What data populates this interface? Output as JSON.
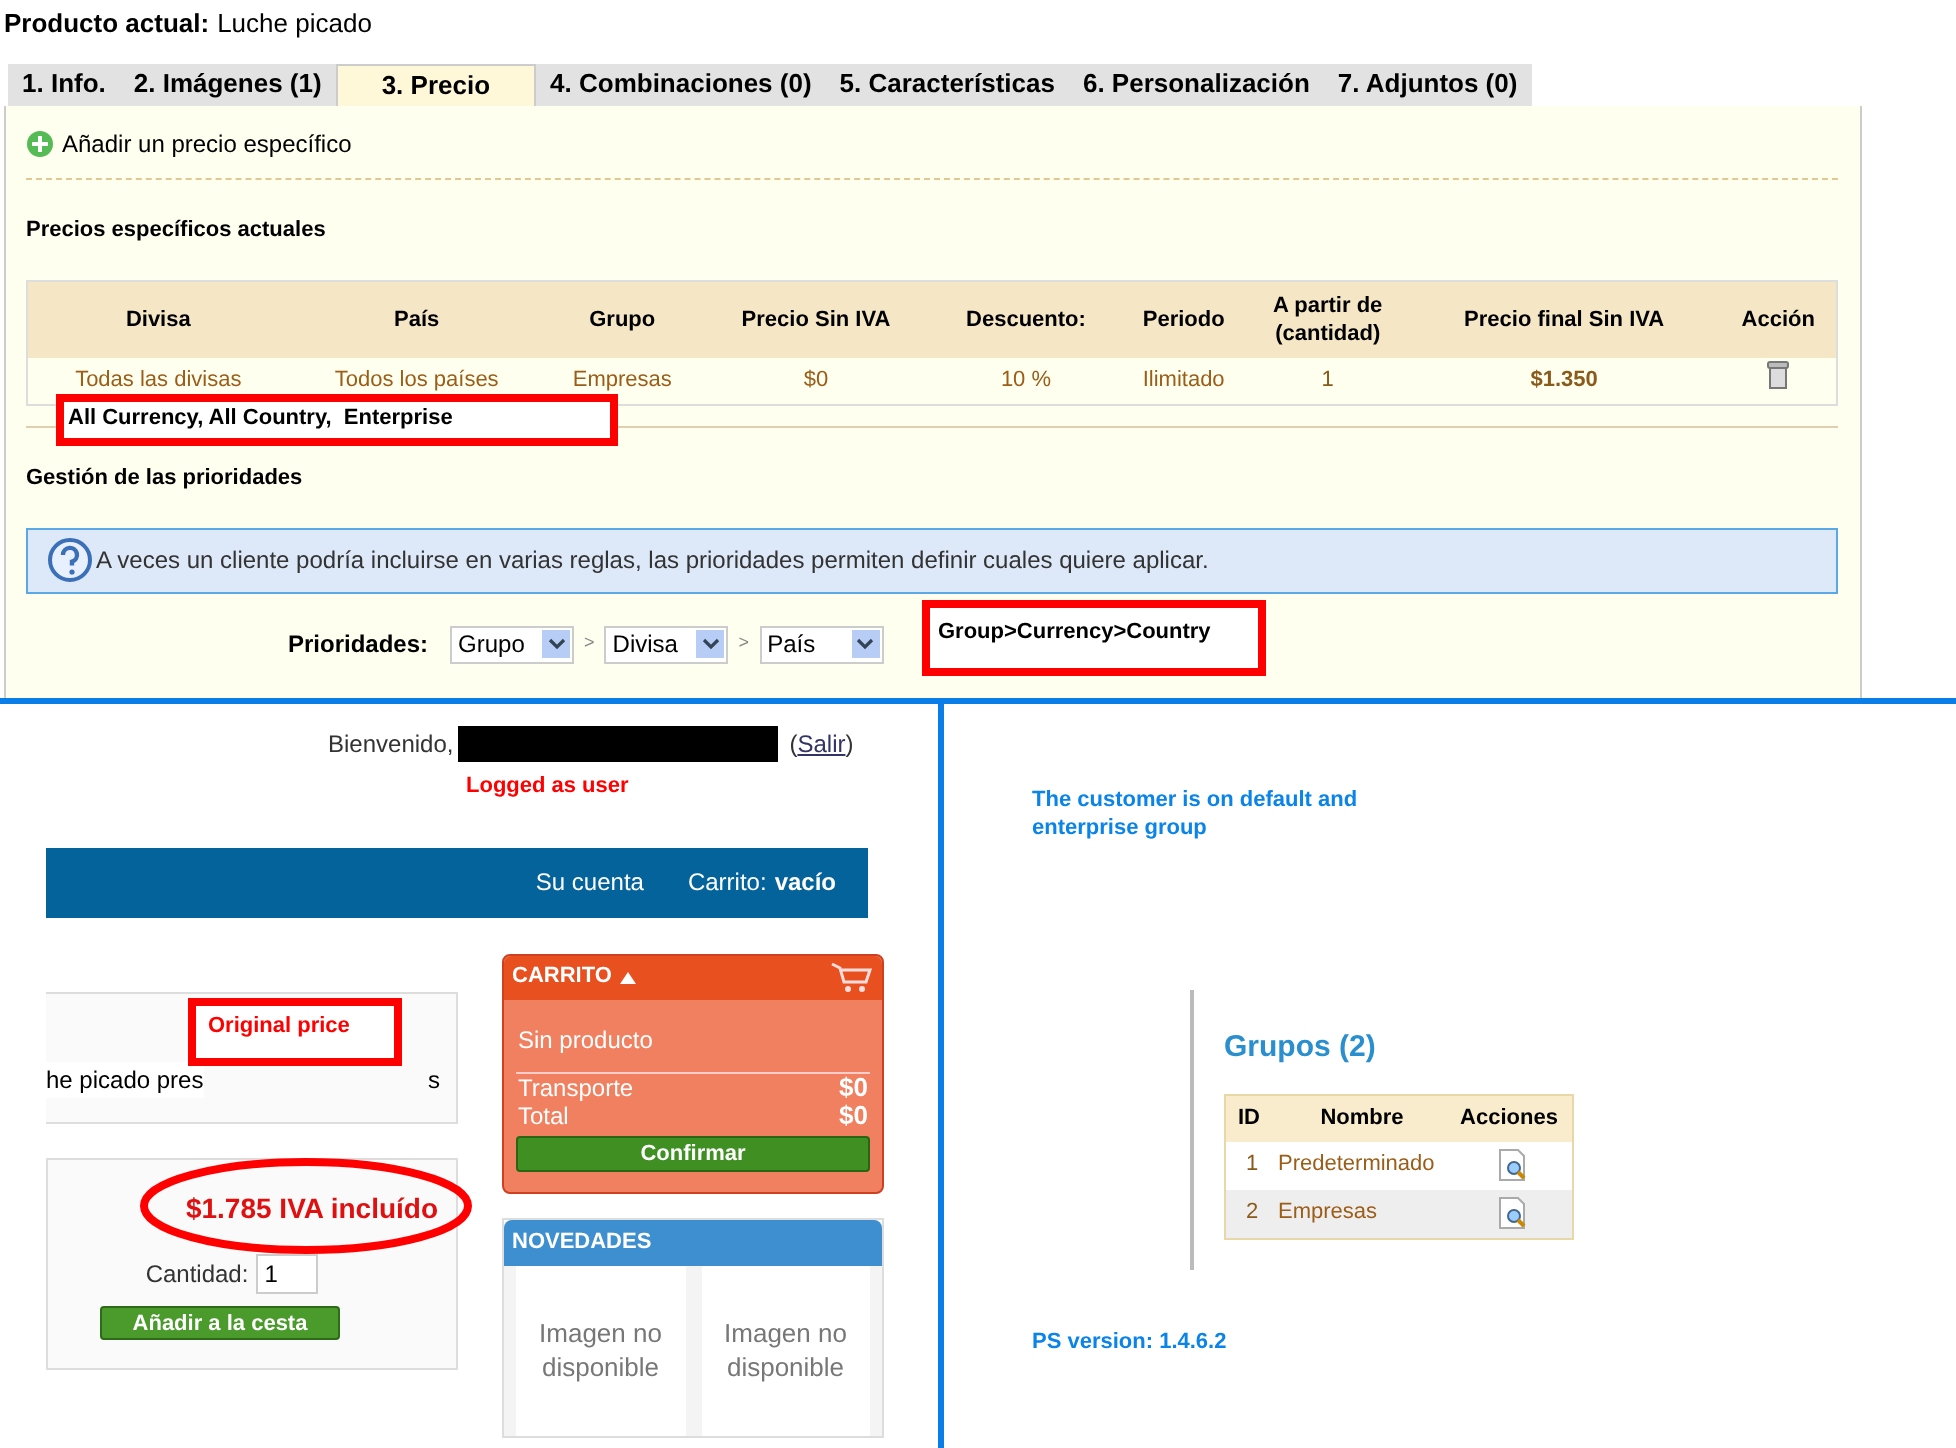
{
  "product": {
    "label": "Producto actual:",
    "name": "Luche picado"
  },
  "tabs": [
    {
      "label": "1. Info.",
      "selected": false
    },
    {
      "label": "2. Imágenes (1)",
      "selected": false
    },
    {
      "label": "3. Precio",
      "selected": true
    },
    {
      "label": "4. Combinaciones (0)",
      "selected": false
    },
    {
      "label": "5. Características",
      "selected": false
    },
    {
      "label": "6. Personalización",
      "selected": false
    },
    {
      "label": "7. Adjuntos (0)",
      "selected": false
    }
  ],
  "add_link": "Añadir un precio específico",
  "specific_prices": {
    "title": "Precios específicos actuales",
    "columns": [
      "Divisa",
      "País",
      "Grupo",
      "Precio Sin IVA",
      "Descuento:",
      "Periodo",
      "A partir de (cantidad)",
      "Precio final Sin IVA",
      "Acción"
    ],
    "rows": [
      {
        "cells": [
          "Todas las divisas",
          "Todos los países",
          "Empresas",
          "$0",
          "10 %",
          "Ilimitado",
          "1",
          "$1.350"
        ]
      }
    ],
    "annotation": "All Currency, All Country,  Enterprise"
  },
  "priorities": {
    "title": "Gestión de las prioridades",
    "hint": "A veces un cliente podría incluirse en varias reglas, las prioridades permiten definir cuales quiere aplicar.",
    "label": "Prioridades:",
    "selects": [
      "Grupo",
      "Divisa",
      "País"
    ],
    "separators": [
      ">",
      ">"
    ],
    "annotation": "Group>Currency>Country"
  },
  "store": {
    "welcome": "Bienvenido,",
    "logout": {
      "open": "(",
      "label": "Salir",
      "close": ")"
    },
    "annotation": "Logged as user",
    "nav": {
      "account": "Su cuenta",
      "cart_label": "Carrito:",
      "cart_value": "vacío"
    },
    "product_block": {
      "fragments": [
        "he picado pres",
        "s"
      ],
      "annotation": "Original price",
      "price": "$1.785 IVA incluído",
      "quantity_label": "Cantidad:",
      "quantity": "1",
      "add_button": "Añadir a la cesta"
    },
    "cart": {
      "title": "CARRITO",
      "empty": "Sin producto",
      "lines": [
        {
          "label": "Transporte",
          "value": "$0"
        },
        {
          "label": "Total",
          "value": "$0"
        }
      ],
      "button": "Confirmar"
    },
    "news": {
      "title": "NOVEDADES",
      "items": [
        "Imagen no disponible",
        "Imagen no disponible"
      ]
    }
  },
  "admin": {
    "annotation": "The customer is on default and enterprise group",
    "groups_title": "Grupos (2)",
    "columns": [
      "ID",
      "Nombre",
      "Acciones"
    ],
    "rows": [
      {
        "id": "1",
        "name": "Predeterminado"
      },
      {
        "id": "2",
        "name": "Empresas"
      }
    ],
    "version": "PS version: 1.4.6.2"
  }
}
